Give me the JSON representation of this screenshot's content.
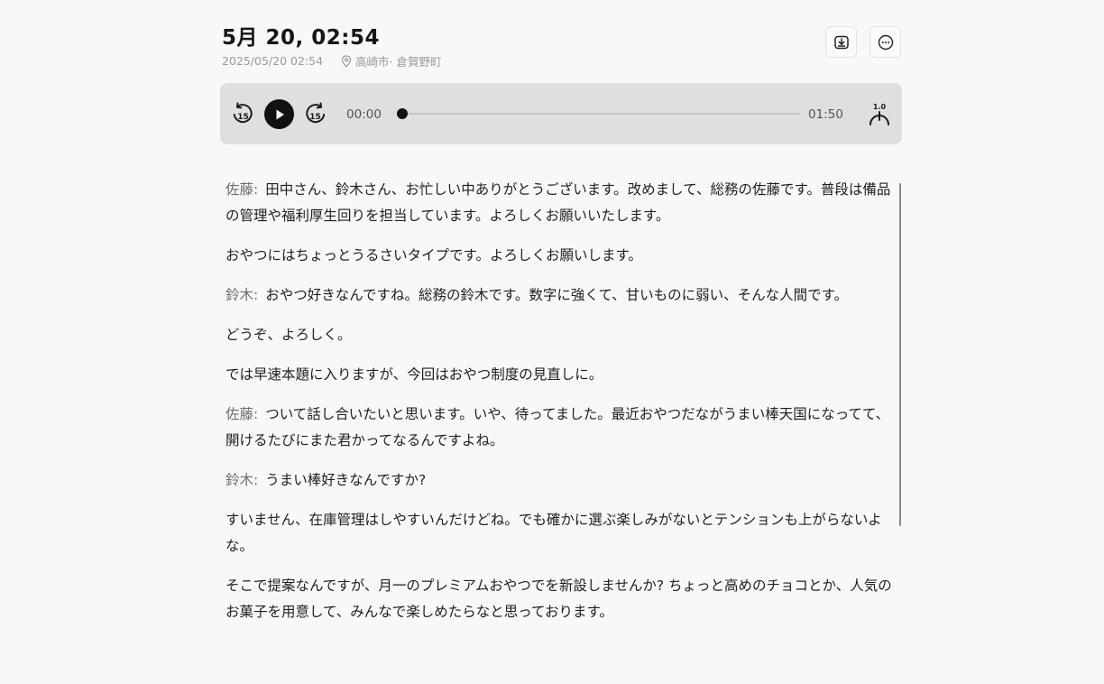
{
  "recording": {
    "title": "5月 20, 02:54",
    "datetime": "2025/05/20 02:54",
    "location": "高崎市· 倉賀野町"
  },
  "actions": {
    "save_icon": "download-to-box-icon",
    "more_icon": "more-horizontal-circle-icon"
  },
  "player": {
    "skip_back_icon": "rewind-15-icon",
    "skip_back_label": "15",
    "play_icon": "play-icon",
    "skip_forward_icon": "forward-15-icon",
    "skip_forward_label": "15",
    "current_time": "00:00",
    "duration": "01:50",
    "progress": 0,
    "speed_label": "1.0",
    "speed_icon": "playback-speed-icon"
  },
  "transcript": [
    {
      "speaker": "佐藤:",
      "text": "田中さん、鈴木さん、お忙しい中ありがとうございます。改めまして、総務の佐藤です。普段は備品の管理や福利厚生回りを担当しています。よろしくお願いいたします。"
    },
    {
      "speaker": "",
      "text": "おやつにはちょっとうるさいタイプです。よろしくお願いします。"
    },
    {
      "speaker": "鈴木:",
      "text": "おやつ好きなんですね。総務の鈴木です。数字に強くて、甘いものに弱い、そんな人間です。"
    },
    {
      "speaker": "",
      "text": "どうぞ、よろしく。"
    },
    {
      "speaker": "",
      "text": "では早速本題に入りますが、今回はおやつ制度の見直しに。"
    },
    {
      "speaker": "佐藤:",
      "text": "ついて話し合いたいと思います。いや、待ってました。最近おやつだながうまい棒天国になってて、開けるたびにまた君かってなるんですよね。"
    },
    {
      "speaker": "鈴木:",
      "text": "うまい棒好きなんですか?"
    },
    {
      "speaker": "",
      "text": "すいません、在庫管理はしやすいんだけどね。でも確かに選ぶ楽しみがないとテンションも上がらないよな。"
    },
    {
      "speaker": "",
      "text": "そこで提案なんですが、月一のプレミアムおやつでを新設しませんか? ちょっと高めのチョコとか、人気のお菓子を用意して、みんなで楽しめたらなと思っております。"
    }
  ],
  "colors": {
    "background": "#f8f8f8",
    "player_bg": "#dfdfdf",
    "speaker_text": "#6e6e6e",
    "meta_text": "#9a9a9a"
  }
}
